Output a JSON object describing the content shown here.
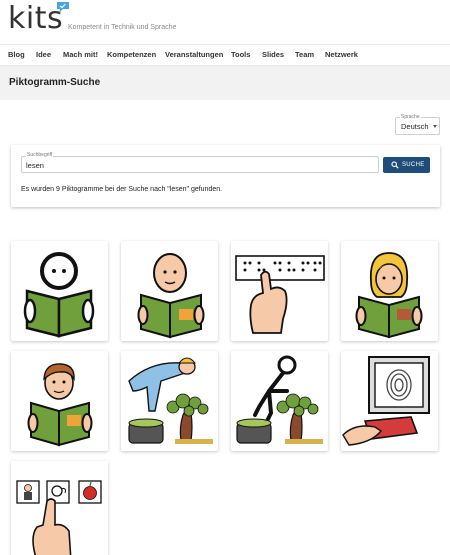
{
  "header": {
    "logo_text": "kits",
    "tagline": "Kompetent in Technik und Sprache",
    "brand_color": "#4aa3df"
  },
  "nav": {
    "items": [
      {
        "label": "Blog"
      },
      {
        "label": "Idee"
      },
      {
        "label": "Mach mit!"
      },
      {
        "label": "Kompetenzen"
      },
      {
        "label": "Veranstaltungen"
      },
      {
        "label": "Tools"
      },
      {
        "label": "Slides"
      },
      {
        "label": "Team"
      },
      {
        "label": "Netzwerk"
      }
    ]
  },
  "page": {
    "title": "Piktogramm-Suche"
  },
  "language_select": {
    "label": "Sprache",
    "value": "Deutsch"
  },
  "search": {
    "field_label": "Suchbegriff",
    "value": "lesen",
    "button_label": "SUCHE",
    "result_text": "Es wurden 9 Piktogramme bei der Suche nach \"lesen\" gefunden.",
    "button_color": "#1f4d7a"
  },
  "pictograms": [
    {
      "icon": "reading-person-icon"
    },
    {
      "icon": "reading-bald-person-icon"
    },
    {
      "icon": "braille-reading-icon"
    },
    {
      "icon": "reading-girl-icon"
    },
    {
      "icon": "reading-boy-icon"
    },
    {
      "icon": "grape-harvest-person-icon"
    },
    {
      "icon": "grape-harvest-stick-icon"
    },
    {
      "icon": "fingerprint-scanner-icon"
    },
    {
      "icon": "hand-pointing-cards-icon"
    }
  ]
}
